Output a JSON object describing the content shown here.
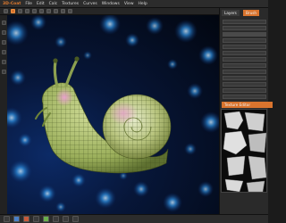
{
  "app": {
    "logo": "3D-Coat"
  },
  "menu": {
    "items": [
      "File",
      "Edit",
      "Calc",
      "Textures",
      "Curves",
      "Windows",
      "View",
      "Help"
    ]
  },
  "right_panel": {
    "tabs": [
      "Layers",
      "Brush"
    ],
    "section": "Texture Editor"
  },
  "colors": {
    "accent": "#d9742e",
    "snail_body": "#a6b868",
    "snail_shell": "#b0c07a",
    "shell_highlight": "#d891c0",
    "background_glow": "#2e8fe0"
  },
  "icons": {
    "viewport_subject": "snail-model"
  }
}
